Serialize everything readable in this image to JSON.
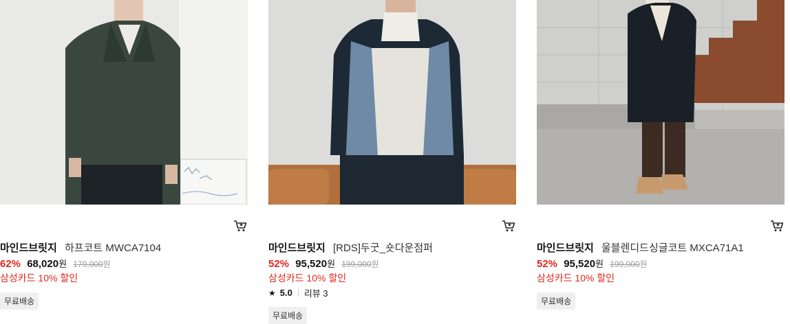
{
  "products": [
    {
      "brand": "마인드브릿지",
      "name": "하프코트 MWCA7104",
      "discount": "62%",
      "price": "68,020",
      "currency": "원",
      "original_price": "179,000",
      "card_promo": "삼성카드 10% 할인",
      "badge": "무료배송",
      "image_icon": "product-photo",
      "cart_icon": "cart-icon"
    },
    {
      "brand": "마인드브릿지",
      "name": "[RDS]두굿_숏다운점퍼",
      "discount": "52%",
      "price": "95,520",
      "currency": "원",
      "original_price": "199,000",
      "card_promo": "삼성카드 10% 할인",
      "rating_icon": "star-icon",
      "rating": "5.0",
      "review_label": "리뷰 3",
      "badge": "무료배송",
      "image_icon": "product-photo",
      "cart_icon": "cart-icon"
    },
    {
      "brand": "마인드브릿지",
      "name": "울블렌디드싱글코트 MXCA71A1",
      "discount": "52%",
      "price": "95,520",
      "currency": "원",
      "original_price": "199,000",
      "card_promo": "삼성카드 10% 할인",
      "badge": "무료배송",
      "image_icon": "product-photo",
      "cart_icon": "cart-icon"
    }
  ],
  "colors": {
    "discount": "#e0271d",
    "card_promo": "#e0271d",
    "badge_bg": "#efefef"
  }
}
